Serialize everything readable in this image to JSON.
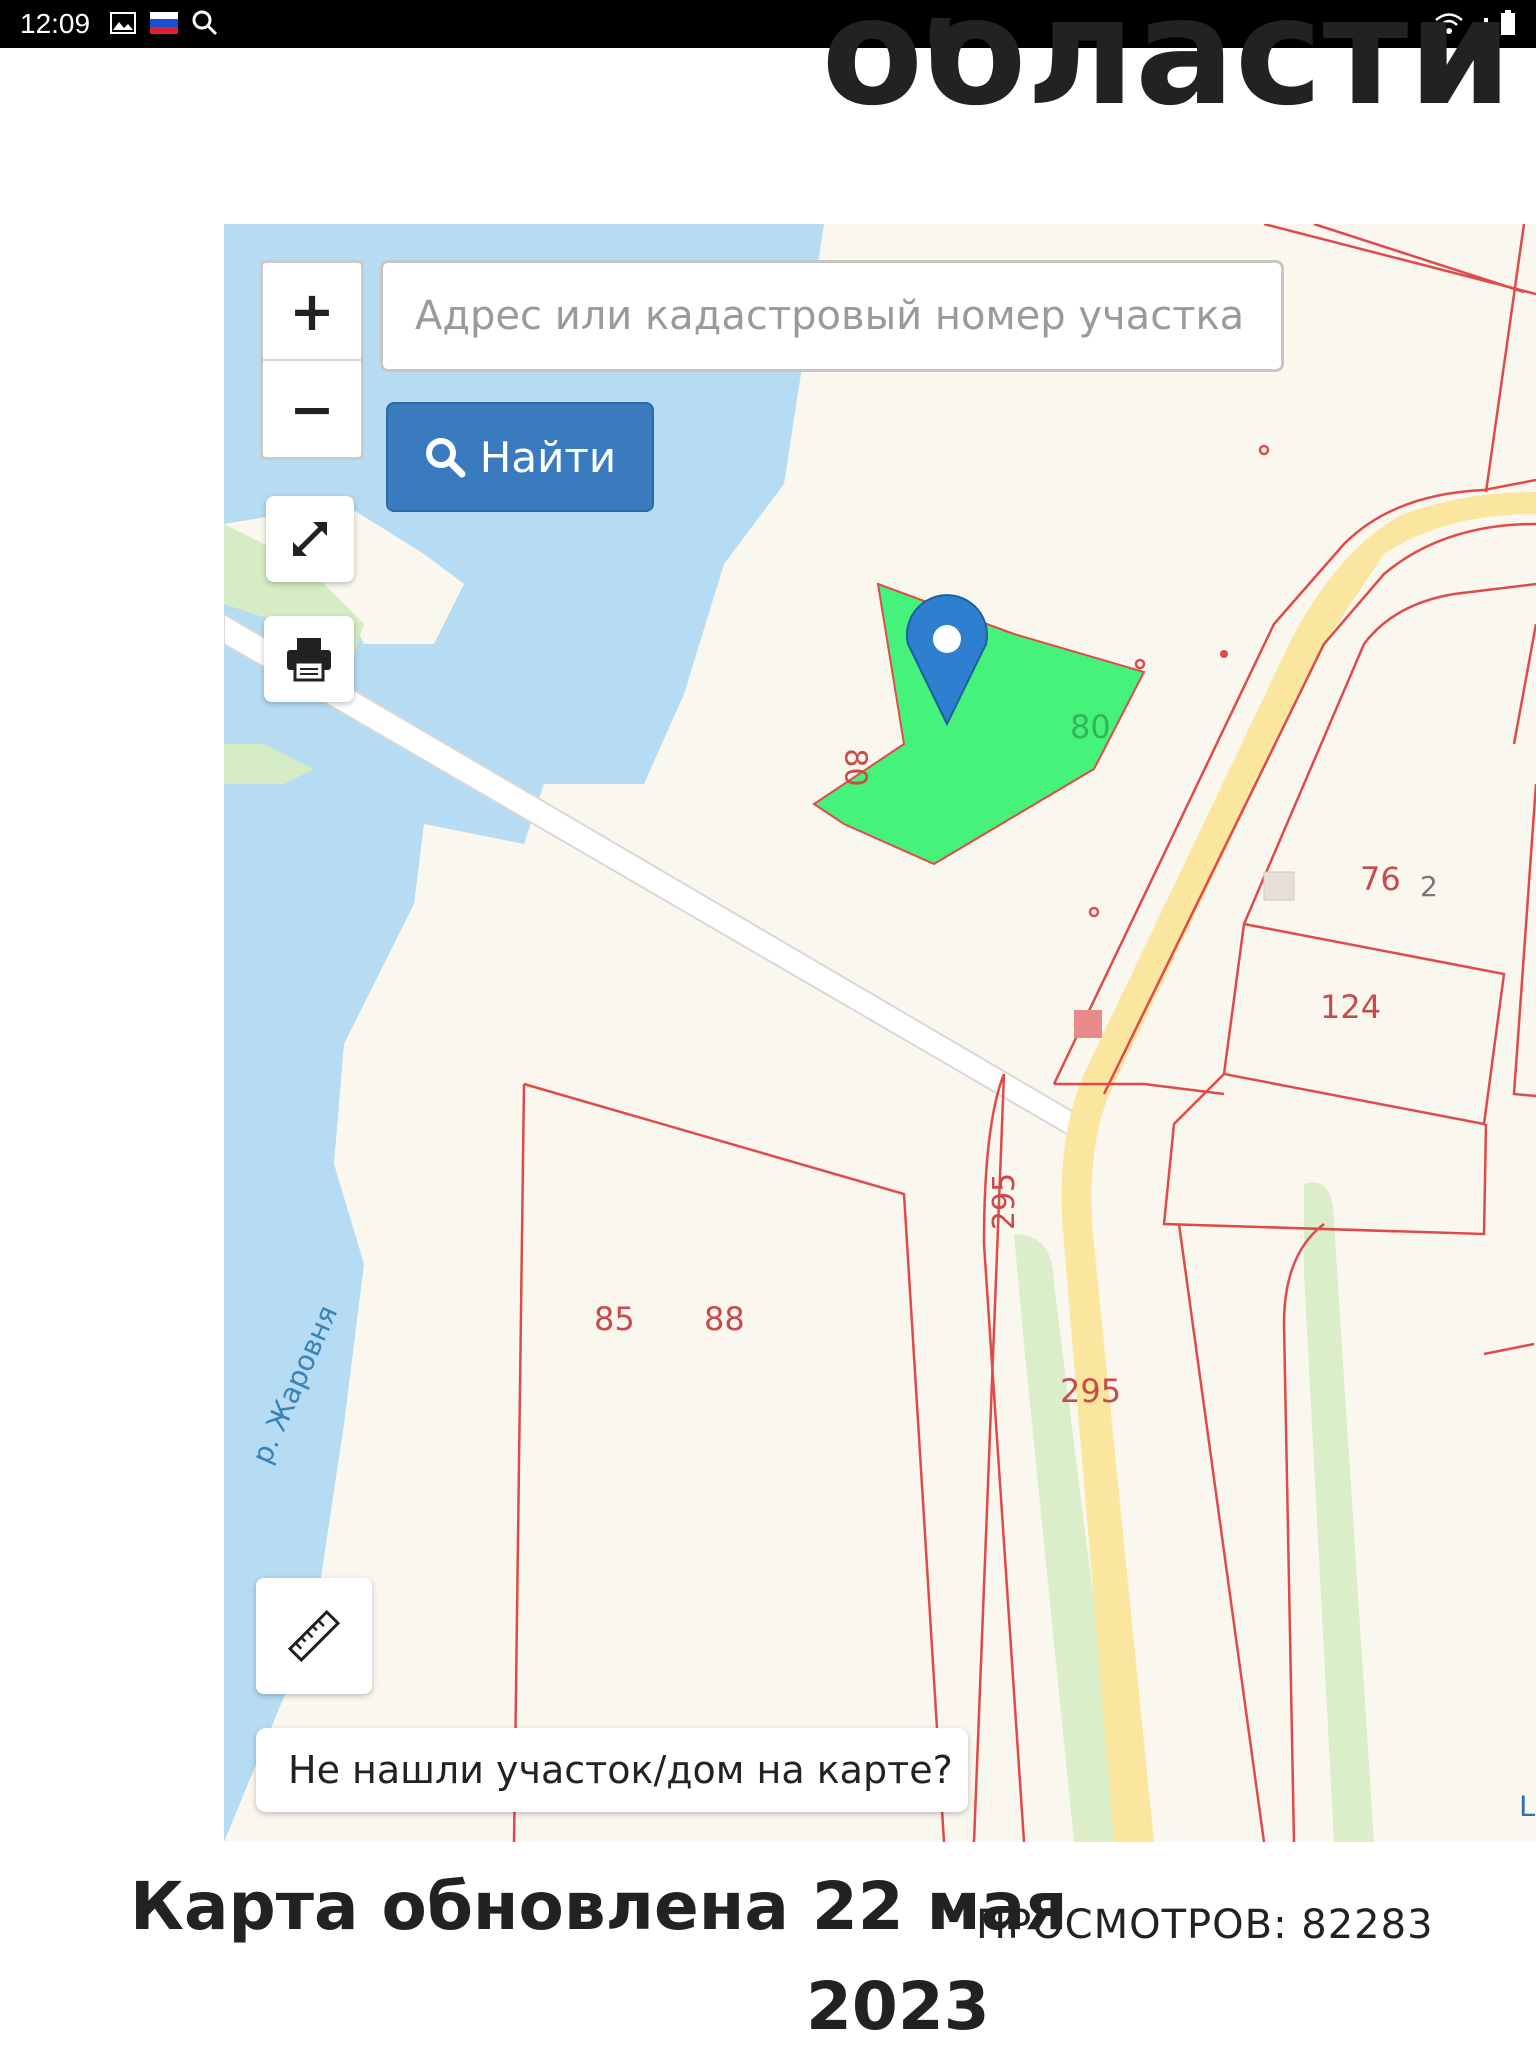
{
  "status_bar": {
    "time": "12:09"
  },
  "page": {
    "region_title": "области"
  },
  "map": {
    "search": {
      "placeholder": "Адрес или кадастровый номер участка",
      "button_label": "Найти"
    },
    "zoom": {
      "in": "+",
      "out": "−"
    },
    "not_found_label": "Не нашли участок/дом на карте?",
    "attribution": "L",
    "labels": {
      "plot_green_a": "80",
      "plot_green_b": "80",
      "plot_76": "76",
      "plot_76_box": "2",
      "plot_124": "124",
      "road_295_a": "295",
      "road_295_b": "295",
      "plot_85": "85",
      "plot_88": "88",
      "river": "р. Жаровня"
    },
    "colors": {
      "water": "#b5dcf3",
      "land": "#faf8ee",
      "boundary": "#e04a4a",
      "selected_plot": "#45f37a",
      "road": "#fbe6a0",
      "green": "#d6ecc4",
      "marker": "#2f7fd0"
    }
  },
  "footer": {
    "updated_line1": "Карта обновлена 22 мая",
    "updated_line2": "2023",
    "views_label": "ПРОСМОТРОВ: 82283"
  }
}
